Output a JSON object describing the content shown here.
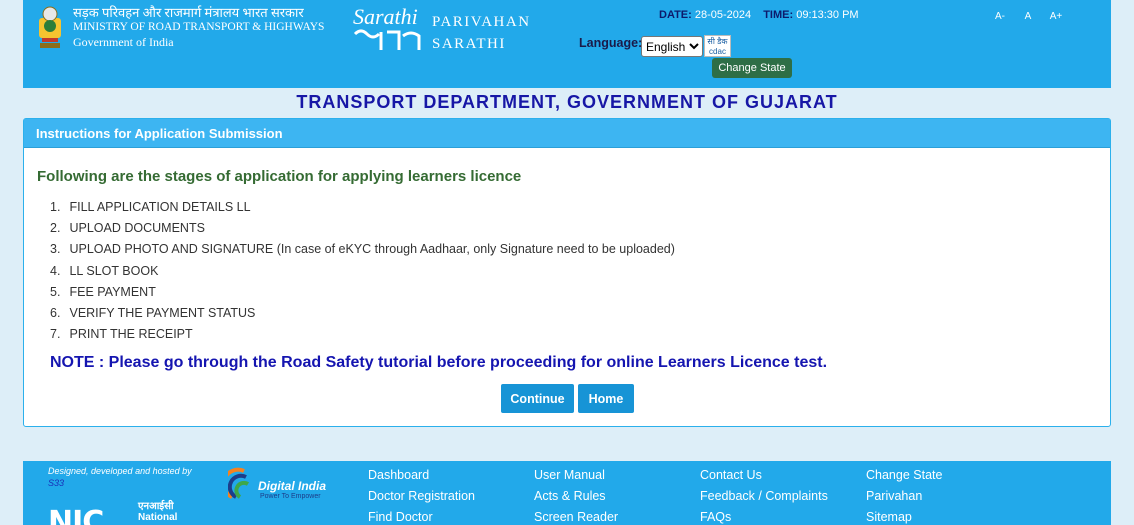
{
  "header": {
    "ministry_hindi": "सड़क परिवहन और राजमार्ग मंत्रालय भारत सरकार",
    "ministry_english": "MINISTRY OF ROAD TRANSPORT & HIGHWAYS",
    "government": "Government of India",
    "sarathi_logo_text": "Sarathi",
    "brand_line1": "PARIVAHAN",
    "brand_line2": "SARATHI",
    "date_label": "DATE:",
    "date_value": "28-05-2024",
    "time_label": "TIME:",
    "time_value": "09:13:30 PM",
    "font_small": "A-",
    "font_normal": "A",
    "font_large": "A+",
    "language_label": "Language:",
    "language_selected": "English",
    "cdac_text": "सी डैक",
    "cdac_logo": "cdac",
    "change_state": "Change State"
  },
  "department_title": "TRANSPORT DEPARTMENT, GOVERNMENT OF GUJARAT",
  "panel": {
    "heading": "Instructions for Application Submission",
    "stages_title": "Following are the stages of application for applying learners licence",
    "stages": [
      {
        "num": "1.",
        "text": "FILL APPLICATION DETAILS LL"
      },
      {
        "num": "2.",
        "text": "UPLOAD DOCUMENTS"
      },
      {
        "num": "3.",
        "text": "UPLOAD PHOTO AND SIGNATURE (In case of eKYC through Aadhaar, only Signature need to be uploaded)"
      },
      {
        "num": "4.",
        "text": "LL SLOT BOOK"
      },
      {
        "num": "5.",
        "text": "FEE PAYMENT"
      },
      {
        "num": "6.",
        "text": "VERIFY THE PAYMENT STATUS"
      },
      {
        "num": "7.",
        "text": "PRINT THE RECEIPT"
      }
    ],
    "note": "NOTE : Please go through the Road Safety tutorial before proceeding for online Learners Licence test.",
    "continue_label": "Continue",
    "home_label": "Home"
  },
  "footer": {
    "designed_by": "Designed, developed and hosted by",
    "designed_code": "S33",
    "nic_logo": "NIC",
    "nic_hindi": "एनआईसी",
    "nic_english": "National",
    "digital_india": "Digital India",
    "digital_india_tagline": "Power To Empower",
    "col1": [
      "Dashboard",
      "Doctor Registration",
      "Find Doctor"
    ],
    "col2": [
      "User Manual",
      "Acts & Rules",
      "Screen Reader"
    ],
    "col3": [
      "Contact Us",
      "Feedback / Complaints",
      "FAQs"
    ],
    "col4": [
      "Change State",
      "Parivahan",
      "Sitemap"
    ]
  },
  "colors": {
    "header_blue": "#22a9ea",
    "panel_head": "#3db5f2",
    "button_blue": "#1794d6",
    "title_navy": "#1717a6",
    "stage_green": "#356b33",
    "change_state_green": "#2e6e46"
  }
}
